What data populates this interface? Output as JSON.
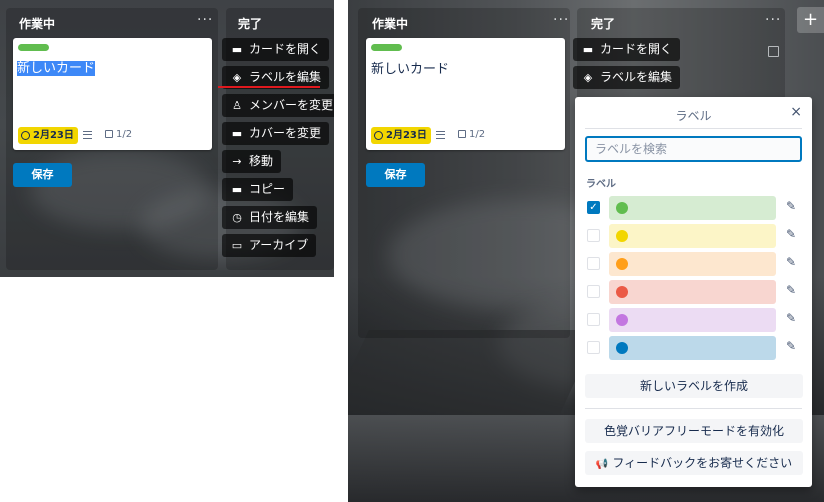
{
  "left": {
    "lists": {
      "doing": "作業中",
      "done": "完了",
      "menu_dots": "···"
    },
    "card": {
      "title": "新しいカード",
      "due": "2月23日",
      "checklist": "1/2"
    },
    "save_label": "保存",
    "quick_actions": [
      {
        "icon": "card-icon",
        "glyph": "▬",
        "label": "カードを開く"
      },
      {
        "icon": "tag-icon",
        "glyph": "◈",
        "label": "ラベルを編集"
      },
      {
        "icon": "person-icon",
        "glyph": "♙",
        "label": "メンバーを変更"
      },
      {
        "icon": "cover-icon",
        "glyph": "▬",
        "label": "カバーを変更"
      },
      {
        "icon": "arrow-right-icon",
        "glyph": "→",
        "label": "移動"
      },
      {
        "icon": "copy-icon",
        "glyph": "▬",
        "label": "コピー"
      },
      {
        "icon": "clock-icon",
        "glyph": "◷",
        "label": "日付を編集"
      },
      {
        "icon": "archive-icon",
        "glyph": "▭",
        "label": "アーカイブ"
      }
    ],
    "highlight_color": "#e0191e"
  },
  "right": {
    "lists": {
      "doing": "作業中",
      "done": "完了",
      "menu_dots": "···",
      "add": "+"
    },
    "card": {
      "title": "新しいカード",
      "due": "2月23日",
      "checklist": "1/2"
    },
    "save_label": "保存",
    "quick_actions": [
      {
        "icon": "card-icon",
        "glyph": "▬",
        "label": "カードを開く"
      },
      {
        "icon": "tag-icon",
        "glyph": "◈",
        "label": "ラベルを編集"
      }
    ],
    "popover": {
      "title": "ラベル",
      "close": "×",
      "search_placeholder": "ラベルを検索",
      "section_label": "ラベル",
      "labels": [
        {
          "color_name": "green",
          "bar": "#d6ecd2",
          "dot": "#61bd4f",
          "checked": true
        },
        {
          "color_name": "yellow",
          "bar": "#fcf5c7",
          "dot": "#f2d600",
          "checked": false
        },
        {
          "color_name": "orange",
          "bar": "#fde7cf",
          "dot": "#ff9f1a",
          "checked": false
        },
        {
          "color_name": "red",
          "bar": "#f8d6d0",
          "dot": "#eb5a46",
          "checked": false
        },
        {
          "color_name": "purple",
          "bar": "#ecdcf3",
          "dot": "#c377e0",
          "checked": false
        },
        {
          "color_name": "blue",
          "bar": "#bcd9ea",
          "dot": "#0079bf",
          "checked": false
        }
      ],
      "check_glyph": "✓",
      "edit_glyph": "✎",
      "create_label": "新しいラベルを作成",
      "colorblind_label": "色覚バリアフリーモードを有効化",
      "feedback_label": "フィードバックをお寄せください",
      "feedback_glyph": "📢"
    }
  }
}
